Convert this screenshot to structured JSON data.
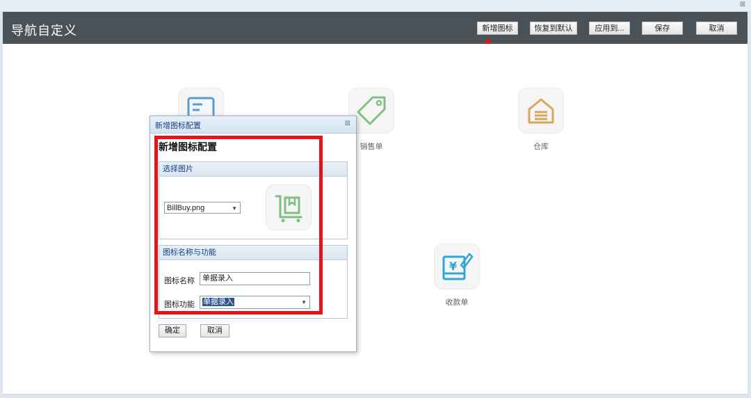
{
  "window": {
    "close_glyph": "⊠"
  },
  "header": {
    "title": "导航自定义",
    "buttons": {
      "add_icon": "新增图标",
      "restore_default": "恢复到默认",
      "apply_to": "应用到...",
      "save": "保存",
      "cancel": "取消"
    }
  },
  "canvas": {
    "tiles": [
      {
        "label": "",
        "icon": "bill-icon",
        "color": "#5b9bd5"
      },
      {
        "label": "销售单",
        "icon": "price-tag-icon",
        "color": "#7fbf7f"
      },
      {
        "label": "仓库",
        "icon": "warehouse-icon",
        "color": "#d6a65b"
      },
      {
        "label": "收款单",
        "icon": "receipt-yen-icon",
        "color": "#2fa7d6"
      }
    ]
  },
  "dialog": {
    "title": "新增图标配置",
    "heading": "新增图标配置",
    "close_glyph": "⊠",
    "section_image": {
      "title": "选择图片",
      "select_value": "BillBuy.png",
      "preview_icon": "cart-box-icon",
      "preview_color": "#7fbf7f"
    },
    "section_name": {
      "title": "图标名称与功能",
      "name_label": "图标名称",
      "name_value": "单据录入",
      "function_label": "图标功能",
      "function_value": "单据录入"
    },
    "ok_label": "确定",
    "cancel_label": "取消"
  },
  "annotation": {
    "highlight_color": "#e8121b"
  }
}
